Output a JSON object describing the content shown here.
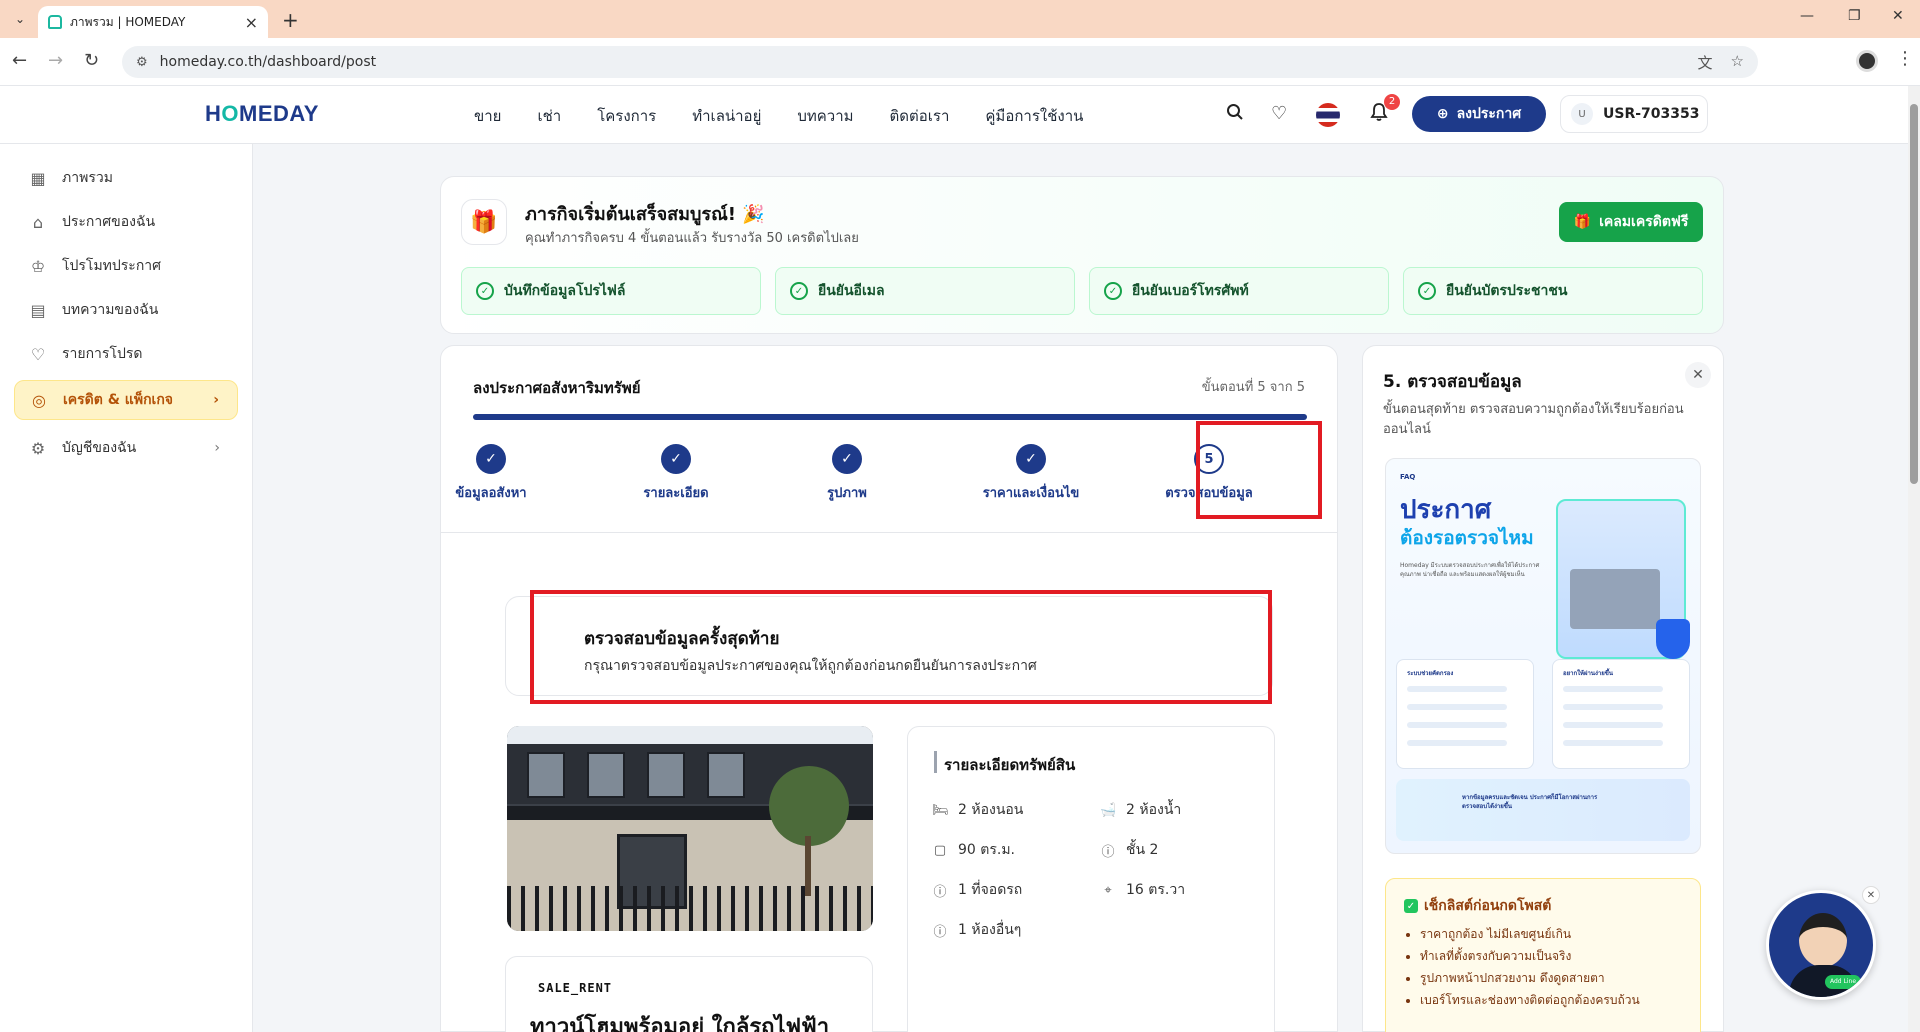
{
  "browser": {
    "tab_title": "ภาพรวม | HOMEDAY",
    "url": "homeday.co.th/dashboard/post"
  },
  "header": {
    "logo_prefix": "H",
    "logo_o": "O",
    "logo_suffix": "MEDAY",
    "nav": [
      "ขาย",
      "เช่า",
      "โครงการ",
      "ทำเลน่าอยู่",
      "บทความ",
      "ติดต่อเรา",
      "คู่มือการใช้งาน"
    ],
    "notification_count": "2",
    "post_button": "ลงประกาศ",
    "avatar_letter": "U",
    "user_id": "USR-703353"
  },
  "sidebar": {
    "items": [
      {
        "label": "ภาพรวม",
        "icon": "grid-icon"
      },
      {
        "label": "ประกาศของฉัน",
        "icon": "home-icon"
      },
      {
        "label": "โปรโมทประกาศ",
        "icon": "crown-icon"
      },
      {
        "label": "บทความของฉัน",
        "icon": "document-icon"
      },
      {
        "label": "รายการโปรด",
        "icon": "heart-icon"
      },
      {
        "label": "เครดิต & แพ็กเกจ",
        "icon": "coins-icon"
      },
      {
        "label": "บัญชีของฉัน",
        "icon": "gear-icon"
      }
    ]
  },
  "mission": {
    "title": "ภารกิจเริ่มต้นเสร็จสมบูรณ์! 🎉",
    "subtitle": "คุณทำภารกิจครบ 4 ขั้นตอนแล้ว รับรางวัล 50 เครดิตไปเลย",
    "claim_button": "เคลมเครดิตฟรี",
    "tasks": [
      "บันทึกข้อมูลโปรไฟล์",
      "ยืนยันอีเมล",
      "ยืนยันเบอร์โทรศัพท์",
      "ยืนยันบัตรประชาชน"
    ]
  },
  "form": {
    "title": "ลงประกาศอสังหาริมทรัพย์",
    "step_count": "ขั้นตอนที่ 5 จาก 5",
    "progress_fraction": 1.0,
    "steps": [
      {
        "label": "ข้อมูลอสังหา",
        "mark": "✓"
      },
      {
        "label": "รายละเอียด",
        "mark": "✓"
      },
      {
        "label": "รูปภาพ",
        "mark": "✓"
      },
      {
        "label": "ราคาและเงื่อนไข",
        "mark": "✓"
      },
      {
        "label": "ตรวจสอบข้อมูล",
        "mark": "5"
      }
    ],
    "review_title": "ตรวจสอบข้อมูลครั้งสุดท้าย",
    "review_subtitle": "กรุณาตรวจสอบข้อมูลประกาศของคุณให้ถูกต้องก่อนกดยืนยันการลงประกาศ",
    "listing_type": "SALE_RENT",
    "listing_title": "ทาวน์โฮมพร้อมอยู่ ใกล้รถไฟฟ้า",
    "detail_title": "รายละเอียดทรัพย์สิน",
    "specs": {
      "bedrooms": "2 ห้องนอน",
      "bathrooms": "2 ห้องน้ำ",
      "area": "90 ตร.ม.",
      "floor": "ชั้น 2",
      "parking": "1 ที่จอดรถ",
      "land": "16 ตร.วา",
      "other_rooms": "1 ห้องอื่นๆ"
    }
  },
  "help": {
    "title": "5. ตรวจสอบข้อมูล",
    "description": "ขั้นตอนสุดท้าย ตรวจสอบความถูกต้องให้เรียบร้อยก่อนออนไลน์",
    "faq_tag": "FAQ",
    "faq_heading1": "ประกาศ",
    "faq_heading2": "ต้องรอตรวจไหม",
    "faq_blurb": "Homeday มีระบบตรวจสอบประกาศเพื่อให้ได้ประกาศคุณภาพ น่าเชื่อถือ และพร้อมแสดงผลให้ผู้ชมเห็น",
    "faq_box1_title": "ระบบช่วยคัดกรอง",
    "faq_box2_title": "อยากให้ผ่านง่ายขึ้น",
    "faq_footer": "หากข้อมูลครบและชัดเจน ประกาศก็มีโอกาสผ่านการตรวจสอบได้ง่ายขึ้น",
    "checklist_title": "เช็กลิสต์ก่อนกดโพสต์",
    "checklist": [
      "ราคาถูกต้อง ไม่มีเลขศูนย์เกิน",
      "ทำเลที่ตั้งตรงกับความเป็นจริง",
      "รูปภาพหน้าปกสวยงาม ดึงดูดสายตา",
      "เบอร์โทรและช่องทางติดต่อถูกต้องครบถ้วน"
    ]
  },
  "chat": {
    "badge": "Add Line"
  },
  "colors": {
    "brand": "#1e3a8a",
    "accent": "#14b8a6",
    "success": "#16a34a",
    "annotation": "#e21b23"
  }
}
